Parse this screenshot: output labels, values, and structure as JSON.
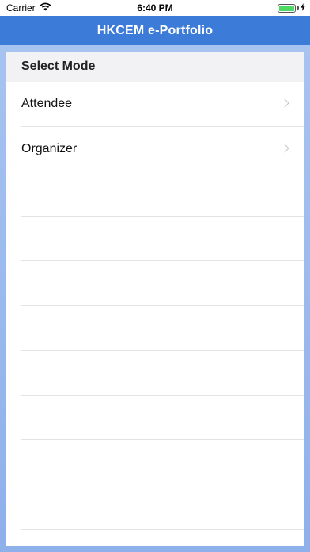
{
  "status_bar": {
    "carrier": "Carrier",
    "time": "6:40 PM",
    "wifi_icon": "wifi-icon",
    "battery_icon": "battery-icon",
    "battery_level": 1.0,
    "charging_icon": "charging-bolt-icon"
  },
  "nav": {
    "title": "HKCEM e-Portfolio",
    "bar_color": "#3d7bd9"
  },
  "list": {
    "header": "Select Mode",
    "items": [
      {
        "label": "Attendee",
        "icon": "chevron-right-icon"
      },
      {
        "label": "Organizer",
        "icon": "chevron-right-icon"
      }
    ],
    "empty_rows": 8
  }
}
